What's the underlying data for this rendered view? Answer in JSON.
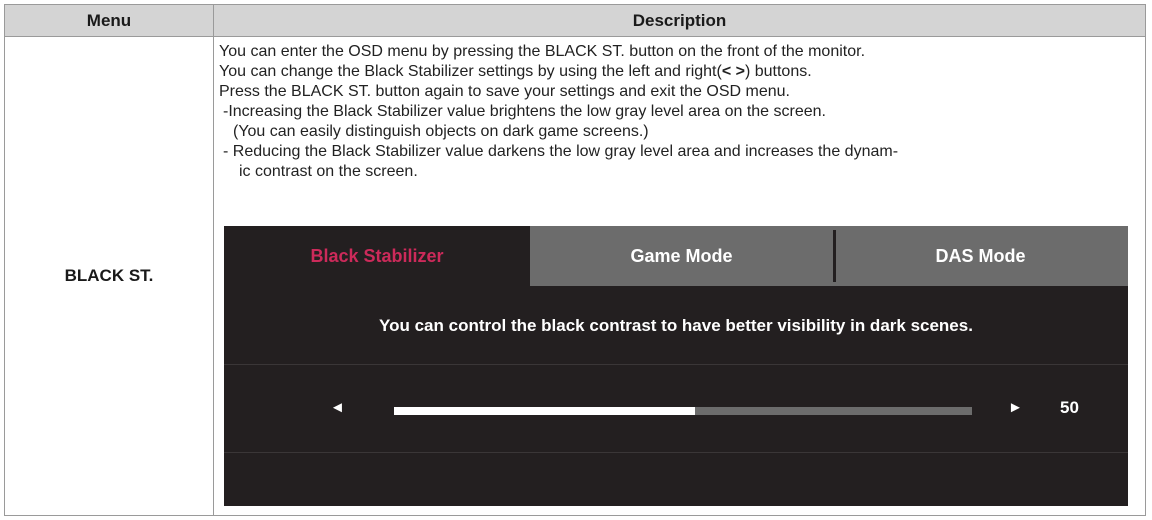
{
  "header": {
    "menu": "Menu",
    "description": "Description"
  },
  "row": {
    "menu": "BLACK ST.",
    "lines": [
      "You can enter the OSD menu by pressing the BLACK ST. button on the front of the monitor.",
      "You can change the Black Stabilizer settings by using the left and right(",
      "< >",
      ") buttons.",
      "Press the BLACK ST. button again to save your settings and exit the OSD menu.",
      "-Increasing the Black Stabilizer value brightens the low gray level area on the screen.",
      "(You can easily distinguish objects on dark game screens.)",
      "- Reducing the Black Stabilizer value darkens the low gray level area and increases the dynam-",
      "ic contrast on the screen."
    ]
  },
  "osd": {
    "tabs": [
      "Black Stabilizer",
      "Game Mode",
      "DAS Mode"
    ],
    "active_tab_color": "#cc2a5a",
    "message": "You can control the black contrast to have better visibility in dark scenes.",
    "left_arrow": "◄",
    "right_arrow": "►",
    "value": "50",
    "slider_fraction": 0.52
  }
}
